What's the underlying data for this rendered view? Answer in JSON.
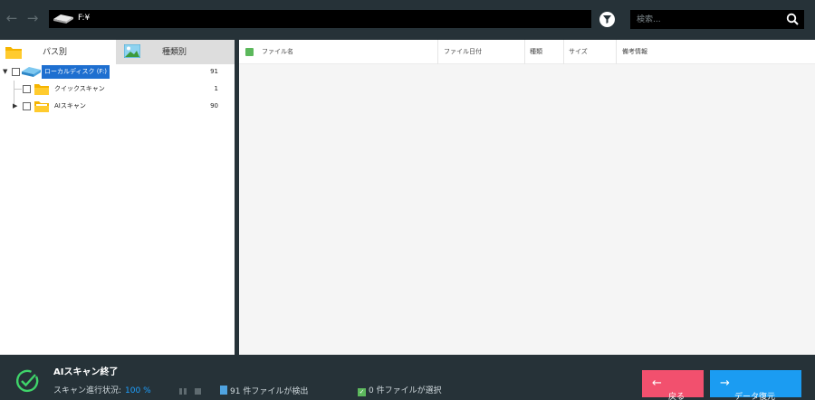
{
  "toolbar": {
    "back_icon": "arrow-left-icon",
    "forward_icon": "arrow-right-icon",
    "path": "F:¥",
    "filter_icon": "filter-icon",
    "search_placeholder": "検索...",
    "search_value": ""
  },
  "tabs": [
    {
      "label": "パス別",
      "icon": "folder-icon"
    },
    {
      "label": "種類別",
      "icon": "image-icon"
    }
  ],
  "tree": [
    {
      "label": "ローカルディスク (F:)",
      "count": "91",
      "toggle": "▼",
      "icon": "drive-icon",
      "selected": true
    },
    {
      "label": "クイックスキャン",
      "count": "1",
      "toggle": "",
      "icon": "folder-icon"
    },
    {
      "label": "AIスキャン",
      "count": "90",
      "toggle": "▶",
      "icon": "folder-icon"
    }
  ],
  "columns": [
    "ファイル名",
    "ファイル日付",
    "種類",
    "サイズ",
    "備考情報"
  ],
  "status": {
    "title": "AIスキャン終了",
    "progress_label": "スキャン進行状況:",
    "progress_value": "100 %",
    "found_text": "91 件ファイルが検出",
    "selected_text": "0 件ファイルが選択"
  },
  "buttons": {
    "back_label": "戻る",
    "recover_label": "データ復元"
  },
  "colors": {
    "background": "#263238",
    "accent_blue": "#1b9cf2",
    "accent_pink": "#f2506e",
    "success_green": "#5cb85c"
  }
}
